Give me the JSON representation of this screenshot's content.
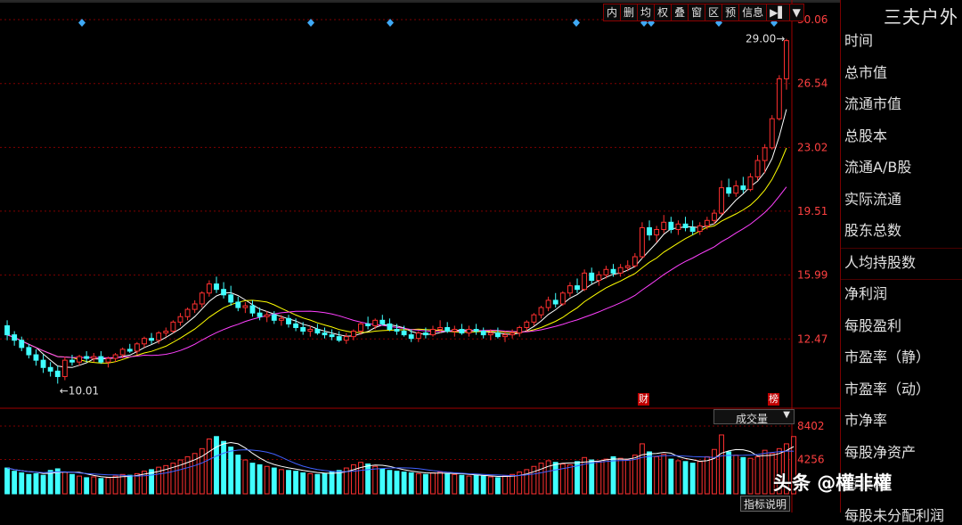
{
  "stock": {
    "name": "三夫户外"
  },
  "toolbar": {
    "buttons": [
      "内",
      "删",
      "均",
      "权",
      "叠",
      "窗",
      "区",
      "预",
      "信息",
      "▶▌",
      "▼"
    ]
  },
  "sidebar": {
    "fields": [
      "时间",
      "总市值",
      "流通市值",
      "总股本",
      "流通A/B股",
      "实际流通",
      "股东总数",
      "人均持股数",
      "净利润",
      "每股盈利",
      "市盈率（静）",
      "市盈率（动）",
      "市净率",
      "每股净资产",
      "每股..",
      "每股未分配利润"
    ]
  },
  "volume_panel": {
    "selector_label": "成交量",
    "indicator_button": "指标说明"
  },
  "markers": {
    "finance": "财",
    "list": "榜"
  },
  "watermark": "头条 @權非權",
  "colors": {
    "up": "#ff3030",
    "down": "#40ffff",
    "ma5": "#ffffff",
    "ma10": "#ffff00",
    "ma20": "#ff40ff",
    "grid": "#800000",
    "axis": "#ff4040"
  },
  "chart_data": [
    {
      "type": "candlestick",
      "price_axis_ticks": [
        30.06,
        26.54,
        23.02,
        19.51,
        15.99,
        12.47
      ],
      "ylim": [
        8.95,
        30.06
      ],
      "annotations": [
        {
          "label": "29.00",
          "at": "max"
        },
        {
          "label": "10.01",
          "at": "min"
        }
      ],
      "moving_averages": [
        "ma5",
        "ma10",
        "ma20"
      ],
      "candles": [
        [
          13.2,
          13.5,
          12.4,
          12.7
        ],
        [
          12.7,
          12.9,
          12.1,
          12.4
        ],
        [
          12.4,
          12.6,
          11.8,
          12.0
        ],
        [
          12.0,
          12.2,
          11.4,
          11.6
        ],
        [
          11.6,
          11.9,
          11.0,
          11.3
        ],
        [
          11.3,
          11.6,
          10.6,
          10.9
        ],
        [
          10.9,
          11.2,
          10.4,
          10.7
        ],
        [
          10.7,
          11.0,
          10.01,
          10.4
        ],
        [
          10.4,
          11.5,
          10.2,
          11.3
        ],
        [
          11.3,
          11.6,
          11.0,
          11.2
        ],
        [
          11.2,
          11.6,
          11.0,
          11.5
        ],
        [
          11.5,
          11.8,
          11.2,
          11.4
        ],
        [
          11.4,
          11.7,
          11.2,
          11.5
        ],
        [
          11.5,
          11.8,
          11.1,
          11.2
        ],
        [
          11.2,
          11.5,
          10.9,
          11.4
        ],
        [
          11.4,
          11.7,
          11.2,
          11.6
        ],
        [
          11.6,
          12.0,
          11.4,
          11.9
        ],
        [
          11.9,
          12.2,
          11.7,
          11.8
        ],
        [
          11.8,
          12.3,
          11.6,
          12.2
        ],
        [
          12.2,
          12.6,
          12.0,
          12.5
        ],
        [
          12.5,
          12.8,
          12.2,
          12.4
        ],
        [
          12.4,
          12.9,
          12.2,
          12.8
        ],
        [
          12.8,
          13.1,
          12.6,
          12.9
        ],
        [
          12.9,
          13.5,
          12.8,
          13.4
        ],
        [
          13.4,
          13.9,
          13.2,
          13.7
        ],
        [
          13.7,
          14.2,
          13.5,
          14.1
        ],
        [
          14.1,
          14.6,
          13.9,
          14.4
        ],
        [
          14.4,
          15.1,
          14.2,
          15.0
        ],
        [
          15.0,
          15.7,
          14.8,
          15.5
        ],
        [
          15.5,
          15.9,
          15.0,
          15.2
        ],
        [
          15.2,
          15.6,
          14.7,
          14.9
        ],
        [
          14.9,
          15.4,
          14.3,
          14.5
        ],
        [
          14.5,
          14.8,
          14.0,
          14.2
        ],
        [
          14.2,
          14.5,
          13.9,
          14.3
        ],
        [
          14.3,
          14.6,
          13.7,
          13.9
        ],
        [
          13.9,
          14.2,
          13.5,
          13.7
        ],
        [
          13.7,
          14.0,
          13.4,
          13.8
        ],
        [
          13.8,
          14.0,
          13.3,
          13.5
        ],
        [
          13.5,
          13.8,
          13.2,
          13.6
        ],
        [
          13.6,
          13.8,
          13.1,
          13.3
        ],
        [
          13.3,
          13.6,
          12.9,
          13.1
        ],
        [
          13.1,
          13.4,
          12.7,
          12.9
        ],
        [
          12.9,
          13.2,
          12.6,
          13.0
        ],
        [
          13.0,
          13.3,
          12.7,
          12.8
        ],
        [
          12.8,
          13.1,
          12.5,
          12.7
        ],
        [
          12.7,
          13.0,
          12.4,
          12.6
        ],
        [
          12.6,
          12.9,
          12.3,
          12.4
        ],
        [
          12.4,
          12.8,
          12.2,
          12.6
        ],
        [
          12.6,
          13.0,
          12.4,
          12.9
        ],
        [
          12.9,
          13.4,
          12.7,
          13.3
        ],
        [
          13.3,
          13.7,
          13.0,
          13.2
        ],
        [
          13.2,
          13.6,
          13.0,
          13.5
        ],
        [
          13.5,
          13.8,
          13.2,
          13.3
        ],
        [
          13.3,
          13.6,
          12.9,
          13.0
        ],
        [
          13.0,
          13.3,
          12.7,
          12.9
        ],
        [
          12.9,
          13.2,
          12.6,
          12.7
        ],
        [
          12.7,
          13.0,
          12.3,
          12.5
        ],
        [
          12.5,
          12.9,
          12.3,
          12.8
        ],
        [
          12.8,
          13.1,
          12.5,
          12.7
        ],
        [
          12.7,
          13.2,
          12.6,
          13.0
        ],
        [
          13.0,
          13.5,
          12.8,
          13.1
        ],
        [
          13.1,
          13.4,
          12.8,
          12.9
        ],
        [
          12.9,
          13.2,
          12.6,
          13.0
        ],
        [
          13.0,
          13.3,
          12.7,
          12.8
        ],
        [
          12.8,
          13.2,
          12.6,
          13.0
        ],
        [
          13.0,
          13.3,
          12.7,
          12.9
        ],
        [
          12.9,
          13.1,
          12.5,
          12.7
        ],
        [
          12.7,
          13.0,
          12.4,
          12.8
        ],
        [
          12.8,
          13.1,
          12.5,
          12.6
        ],
        [
          12.6,
          12.9,
          12.3,
          12.7
        ],
        [
          12.7,
          13.0,
          12.5,
          12.8
        ],
        [
          12.8,
          13.2,
          12.6,
          13.1
        ],
        [
          13.1,
          13.5,
          12.9,
          13.4
        ],
        [
          13.4,
          13.9,
          13.2,
          13.8
        ],
        [
          13.8,
          14.3,
          13.6,
          14.2
        ],
        [
          14.2,
          14.8,
          14.0,
          14.6
        ],
        [
          14.6,
          15.0,
          14.2,
          14.4
        ],
        [
          14.4,
          15.1,
          14.3,
          15.0
        ],
        [
          15.0,
          15.6,
          14.8,
          15.4
        ],
        [
          15.4,
          15.8,
          15.0,
          15.2
        ],
        [
          15.2,
          16.3,
          15.1,
          16.1
        ],
        [
          16.1,
          16.4,
          15.5,
          15.7
        ],
        [
          15.7,
          16.2,
          15.4,
          16.0
        ],
        [
          16.0,
          16.5,
          15.8,
          16.3
        ],
        [
          16.3,
          16.6,
          15.9,
          16.1
        ],
        [
          16.1,
          16.6,
          15.9,
          16.4
        ],
        [
          16.4,
          16.8,
          16.2,
          16.5
        ],
        [
          16.5,
          17.2,
          16.4,
          17.0
        ],
        [
          17.0,
          18.9,
          16.9,
          18.6
        ],
        [
          18.6,
          19.0,
          17.9,
          18.2
        ],
        [
          18.2,
          18.7,
          17.8,
          18.5
        ],
        [
          18.5,
          19.3,
          18.3,
          18.9
        ],
        [
          18.9,
          19.2,
          18.3,
          18.5
        ],
        [
          18.5,
          19.0,
          18.2,
          18.8
        ],
        [
          18.8,
          19.2,
          18.4,
          18.6
        ],
        [
          18.6,
          19.0,
          18.2,
          18.4
        ],
        [
          18.4,
          18.9,
          18.2,
          18.7
        ],
        [
          18.7,
          19.2,
          18.5,
          19.0
        ],
        [
          19.0,
          19.6,
          18.8,
          19.4
        ],
        [
          19.4,
          21.2,
          19.3,
          20.8
        ],
        [
          20.8,
          21.3,
          20.3,
          20.5
        ],
        [
          20.5,
          21.2,
          20.3,
          20.9
        ],
        [
          20.9,
          21.4,
          20.5,
          20.7
        ],
        [
          20.7,
          21.6,
          20.6,
          21.4
        ],
        [
          21.4,
          22.6,
          21.2,
          22.3
        ],
        [
          22.3,
          23.2,
          21.6,
          23.0
        ],
        [
          23.0,
          24.8,
          22.9,
          24.6
        ],
        [
          24.6,
          27.0,
          24.5,
          26.8
        ],
        [
          26.8,
          29.0,
          26.2,
          28.9
        ]
      ]
    },
    {
      "type": "bar",
      "title": "成交量",
      "y_ticks": [
        8402,
        4256
      ],
      "ylim": [
        0,
        8402
      ],
      "values": [
        3200,
        2800,
        2600,
        2400,
        2500,
        2300,
        2900,
        3100,
        2700,
        2400,
        2200,
        2000,
        2100,
        1900,
        2000,
        2200,
        2400,
        2300,
        2500,
        2800,
        3000,
        3300,
        3500,
        3800,
        4200,
        4600,
        5000,
        5600,
        6800,
        7100,
        6500,
        5800,
        4800,
        4200,
        3800,
        3600,
        3400,
        3200,
        3000,
        2900,
        2800,
        2600,
        2500,
        2400,
        2500,
        2700,
        2900,
        3200,
        3600,
        3900,
        3700,
        3400,
        3100,
        2900,
        2800,
        2700,
        2600,
        2500,
        2400,
        2600,
        2700,
        2500,
        2400,
        2300,
        2200,
        2300,
        2200,
        2100,
        2000,
        2200,
        2400,
        2700,
        3000,
        3400,
        3800,
        4100,
        3900,
        3700,
        3600,
        4000,
        4500,
        4200,
        4000,
        4300,
        4600,
        4400,
        4200,
        4800,
        6200,
        5200,
        4600,
        4900,
        4300,
        4100,
        4000,
        3800,
        4000,
        4600,
        5500,
        7300,
        5200,
        4800,
        4500,
        4400,
        4600,
        5400,
        5000,
        5600,
        6200,
        7100
      ]
    }
  ]
}
